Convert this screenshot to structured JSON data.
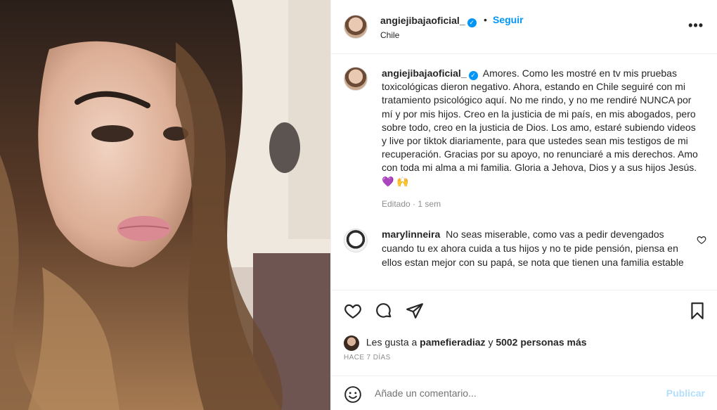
{
  "post": {
    "username": "angiejibajaoficial_",
    "verified_icon": "verified-badge-icon",
    "dot": "•",
    "follow_label": "Seguir",
    "location": "Chile",
    "more_label": "•••"
  },
  "caption": {
    "username": "angiejibajaoficial_",
    "text": "Amores. Como les mostré en tv mis pruebas toxicológicas dieron negativo. Ahora, estando en Chile seguiré con mi tratamiento psicológico aquí. No me rindo, y no me rendiré NUNCA por mí y por mis hijos. Creo en la justicia de mi país, en mis abogados, pero sobre todo, creo en la justicia de Dios. Los amo, estaré subiendo videos y live por tiktok diariamente, para que ustedes sean mis testigos de mi recuperación. Gracias por su apoyo, no renunciaré a mis derechos. Amo con toda mi alma a mi familia. Gloria a Jehova, Dios y a sus hijos Jesús.",
    "emoji_heart": "💜",
    "emoji_hands": "🙌",
    "edited": "Editado",
    "sep": "·",
    "age": "1 sem"
  },
  "comment": {
    "username": "marylinneira",
    "text": "No seas miserable, como vas a pedir devengados cuando tu ex ahora cuida a tus hijos y no te pide pensión, piensa en ellos estan mejor con su papá, se nota que tienen una familia estable"
  },
  "likes": {
    "prefix": "Les gusta a",
    "user": "pamefieradiaz",
    "conj": "y",
    "others": "5002 personas más"
  },
  "date": "HACE 7 DÍAS",
  "composer": {
    "placeholder": "Añade un comentario...",
    "publish_label": "Publicar"
  },
  "colors": {
    "accent": "#0095f6",
    "publish_disabled": "#b2dffc",
    "muted": "#8e8e8e"
  }
}
